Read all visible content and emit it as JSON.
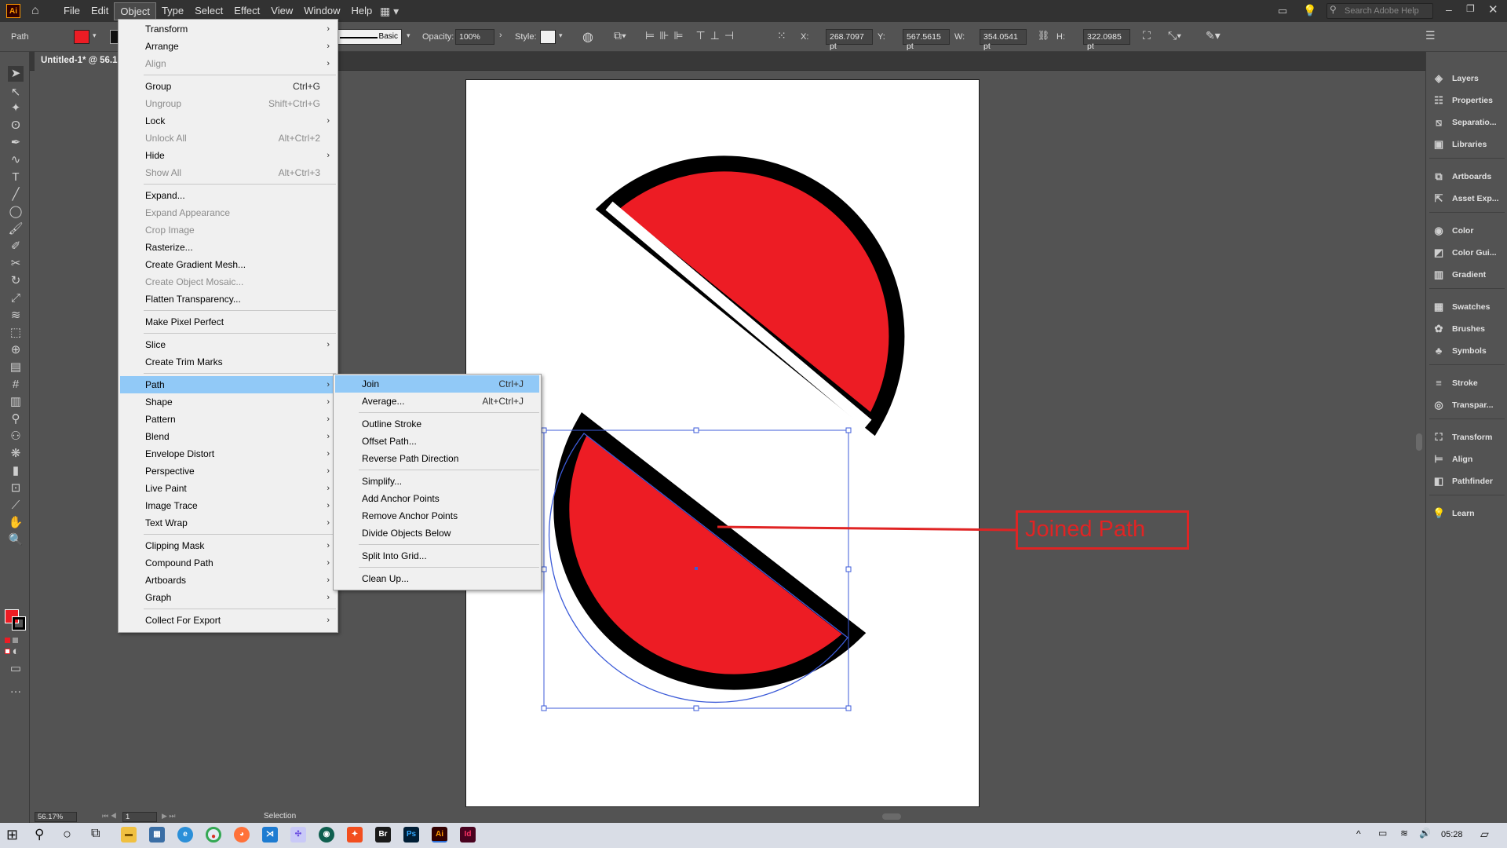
{
  "app": {
    "logo": "Ai",
    "menus": [
      "File",
      "Edit",
      "Object",
      "Type",
      "Select",
      "Effect",
      "View",
      "Window",
      "Help"
    ],
    "active_menu": "Object",
    "search_placeholder": "Search Adobe Help"
  },
  "control_bar": {
    "selection_type": "Path",
    "fill_color": "#ed1c24",
    "stroke_profile": "Basic",
    "opacity_label": "Opacity:",
    "opacity_value": "100%",
    "style_label": "Style:",
    "x_label": "X:",
    "x_value": "268.7097 pt",
    "y_label": "Y:",
    "y_value": "567.5615 pt",
    "w_label": "W:",
    "w_value": "354.0541 pt",
    "h_label": "H:",
    "h_value": "322.0985 pt"
  },
  "document": {
    "tab_title": "Untitled-1* @ 56.17"
  },
  "status_bar": {
    "zoom": "56.17%",
    "artboard_number": "1",
    "tool": "Selection"
  },
  "object_menu": {
    "items": [
      {
        "label": "Transform",
        "shortcut": "",
        "submenu": true,
        "disabled": false
      },
      {
        "label": "Arrange",
        "shortcut": "",
        "submenu": true,
        "disabled": false
      },
      {
        "label": "Align",
        "shortcut": "",
        "submenu": true,
        "disabled": true
      },
      {
        "label": "Group",
        "shortcut": "Ctrl+G",
        "submenu": false,
        "disabled": false
      },
      {
        "label": "Ungroup",
        "shortcut": "Shift+Ctrl+G",
        "submenu": false,
        "disabled": true
      },
      {
        "label": "Lock",
        "shortcut": "",
        "submenu": true,
        "disabled": false
      },
      {
        "label": "Unlock All",
        "shortcut": "Alt+Ctrl+2",
        "submenu": false,
        "disabled": true
      },
      {
        "label": "Hide",
        "shortcut": "",
        "submenu": true,
        "disabled": false
      },
      {
        "label": "Show All",
        "shortcut": "Alt+Ctrl+3",
        "submenu": false,
        "disabled": true
      },
      {
        "label": "Expand...",
        "shortcut": "",
        "submenu": false,
        "disabled": false
      },
      {
        "label": "Expand Appearance",
        "shortcut": "",
        "submenu": false,
        "disabled": true
      },
      {
        "label": "Crop Image",
        "shortcut": "",
        "submenu": false,
        "disabled": true
      },
      {
        "label": "Rasterize...",
        "shortcut": "",
        "submenu": false,
        "disabled": false
      },
      {
        "label": "Create Gradient Mesh...",
        "shortcut": "",
        "submenu": false,
        "disabled": false
      },
      {
        "label": "Create Object Mosaic...",
        "shortcut": "",
        "submenu": false,
        "disabled": true
      },
      {
        "label": "Flatten Transparency...",
        "shortcut": "",
        "submenu": false,
        "disabled": false
      },
      {
        "label": "Make Pixel Perfect",
        "shortcut": "",
        "submenu": false,
        "disabled": false
      },
      {
        "label": "Slice",
        "shortcut": "",
        "submenu": true,
        "disabled": false
      },
      {
        "label": "Create Trim Marks",
        "shortcut": "",
        "submenu": false,
        "disabled": false
      },
      {
        "label": "Path",
        "shortcut": "",
        "submenu": true,
        "disabled": false,
        "highlighted": true
      },
      {
        "label": "Shape",
        "shortcut": "",
        "submenu": true,
        "disabled": false
      },
      {
        "label": "Pattern",
        "shortcut": "",
        "submenu": true,
        "disabled": false
      },
      {
        "label": "Blend",
        "shortcut": "",
        "submenu": true,
        "disabled": false
      },
      {
        "label": "Envelope Distort",
        "shortcut": "",
        "submenu": true,
        "disabled": false
      },
      {
        "label": "Perspective",
        "shortcut": "",
        "submenu": true,
        "disabled": false
      },
      {
        "label": "Live Paint",
        "shortcut": "",
        "submenu": true,
        "disabled": false
      },
      {
        "label": "Image Trace",
        "shortcut": "",
        "submenu": true,
        "disabled": false
      },
      {
        "label": "Text Wrap",
        "shortcut": "",
        "submenu": true,
        "disabled": false
      },
      {
        "label": "Clipping Mask",
        "shortcut": "",
        "submenu": true,
        "disabled": false
      },
      {
        "label": "Compound Path",
        "shortcut": "",
        "submenu": true,
        "disabled": false
      },
      {
        "label": "Artboards",
        "shortcut": "",
        "submenu": true,
        "disabled": false
      },
      {
        "label": "Graph",
        "shortcut": "",
        "submenu": true,
        "disabled": false
      },
      {
        "label": "Collect For Export",
        "shortcut": "",
        "submenu": true,
        "disabled": false
      }
    ]
  },
  "path_submenu": {
    "items": [
      {
        "label": "Join",
        "shortcut": "Ctrl+J",
        "highlighted": true
      },
      {
        "label": "Average...",
        "shortcut": "Alt+Ctrl+J"
      },
      {
        "label": "Outline Stroke",
        "shortcut": ""
      },
      {
        "label": "Offset Path...",
        "shortcut": ""
      },
      {
        "label": "Reverse Path Direction",
        "shortcut": ""
      },
      {
        "label": "Simplify...",
        "shortcut": ""
      },
      {
        "label": "Add Anchor Points",
        "shortcut": ""
      },
      {
        "label": "Remove Anchor Points",
        "shortcut": ""
      },
      {
        "label": "Divide Objects Below",
        "shortcut": ""
      },
      {
        "label": "Split Into Grid...",
        "shortcut": ""
      },
      {
        "label": "Clean Up...",
        "shortcut": ""
      }
    ]
  },
  "right_panel": {
    "items": [
      "Layers",
      "Properties",
      "Separatio...",
      "Libraries",
      "Artboards",
      "Asset Exp...",
      "Color",
      "Color Gui...",
      "Gradient",
      "Swatches",
      "Brushes",
      "Symbols",
      "Stroke",
      "Transpar...",
      "Transform",
      "Align",
      "Pathfinder",
      "Learn"
    ]
  },
  "annotation": {
    "label": "Joined Path",
    "color": "#e02424"
  },
  "taskbar": {
    "time": "05:28",
    "apps": [
      "Br",
      "Ps",
      "Ai",
      "Id"
    ]
  },
  "colors": {
    "shape_fill": "#ed1c24",
    "shape_stroke": "#000000",
    "selection": "#3c5bd8",
    "menu_highlight": "#91c9f7"
  }
}
